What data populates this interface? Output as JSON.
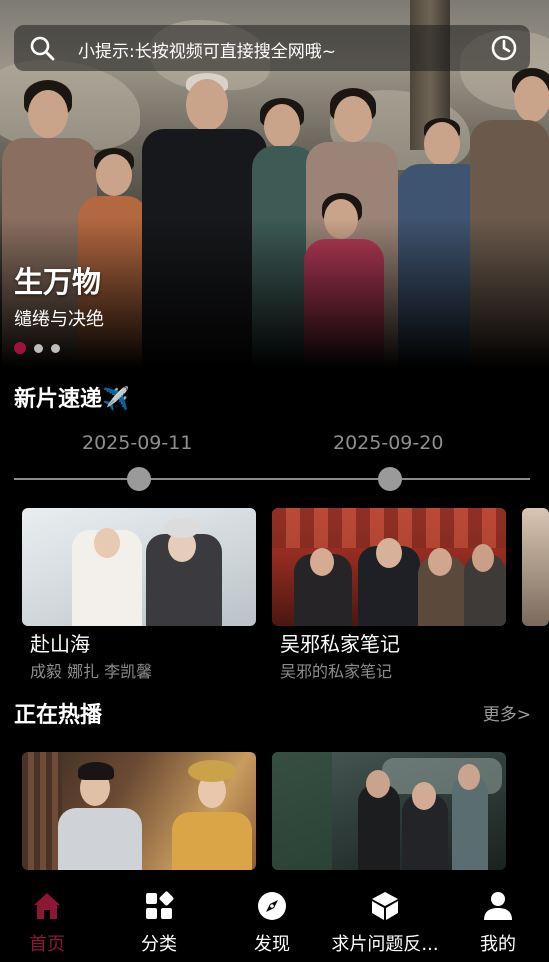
{
  "search": {
    "placeholder": "小提示:长按视频可直接搜全网哦~",
    "left_icon": "search-icon",
    "right_icon": "history-clock-icon"
  },
  "banner": {
    "title": "生万物",
    "subtitle": "缱绻与决绝",
    "dot_count": 3,
    "active_dot": 0,
    "active_color": "#a0123e"
  },
  "new_releases": {
    "title": "新片速递✈️",
    "dates": [
      "2025-09-11",
      "2025-09-20"
    ],
    "items": [
      {
        "title": "赴山海",
        "subtitle": "成毅 娜扎 李凯馨"
      },
      {
        "title": "吴邪私家笔记",
        "subtitle": "吴邪的私家笔记"
      }
    ]
  },
  "now_playing": {
    "title": "正在热播",
    "more": "更多>"
  },
  "nav": {
    "accent_color": "#8c1735",
    "items": [
      {
        "label": "首页",
        "icon": "home-icon",
        "active": true
      },
      {
        "label": "分类",
        "icon": "category-grid-icon",
        "active": false
      },
      {
        "label": "发现",
        "icon": "compass-icon",
        "active": false
      },
      {
        "label": "求片问题反...",
        "icon": "cube-icon",
        "active": false
      },
      {
        "label": "我的",
        "icon": "user-icon",
        "active": false
      }
    ]
  }
}
